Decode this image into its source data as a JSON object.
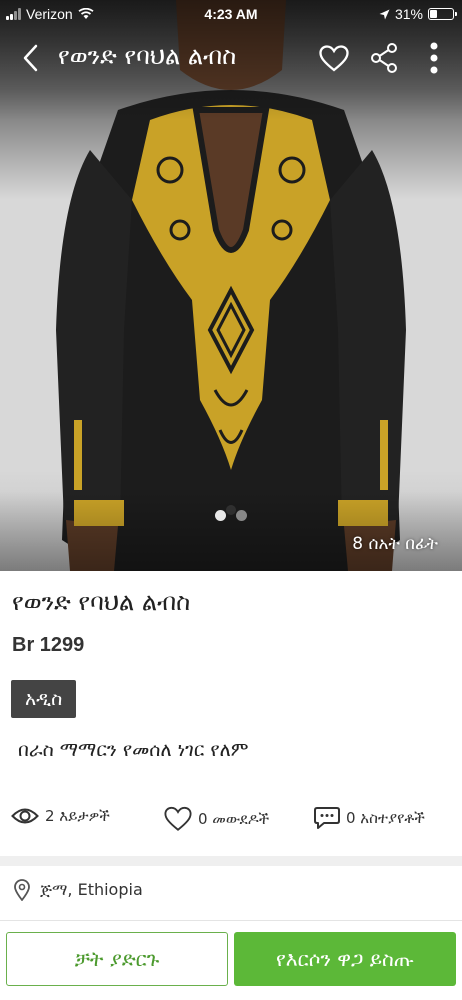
{
  "status_bar": {
    "carrier": "Verizon",
    "time": "4:23 AM",
    "battery": "31%",
    "battery_level": 0.31
  },
  "app_bar": {
    "title": "የወንድ የባህል ልብስ"
  },
  "gallery": {
    "image_count": 2,
    "active_index": 0,
    "time_ago": "8 ሰአት በፊት"
  },
  "product": {
    "title": "የወንድ የባህል ልብስ",
    "price": "Br 1299",
    "condition": "አዲስ",
    "description": "በራስ ማማርን የመሰለ ነገር የለም"
  },
  "stats": {
    "views": "2 እይታዎች",
    "likes": "0 መውደዶች",
    "comments": "0 አስተያየቶች"
  },
  "location": {
    "city": "ጅማ",
    "country": ", Ethiopia"
  },
  "actions": {
    "chat_label": "ቻት ያድርጉ",
    "offer_label": "የእርሶን ዋጋ ይስጡ"
  },
  "colors": {
    "accent_green": "#5cb838",
    "badge_dark": "#444444",
    "garment_black": "#1c1c1c",
    "embroidery_gold": "#c9a227"
  }
}
